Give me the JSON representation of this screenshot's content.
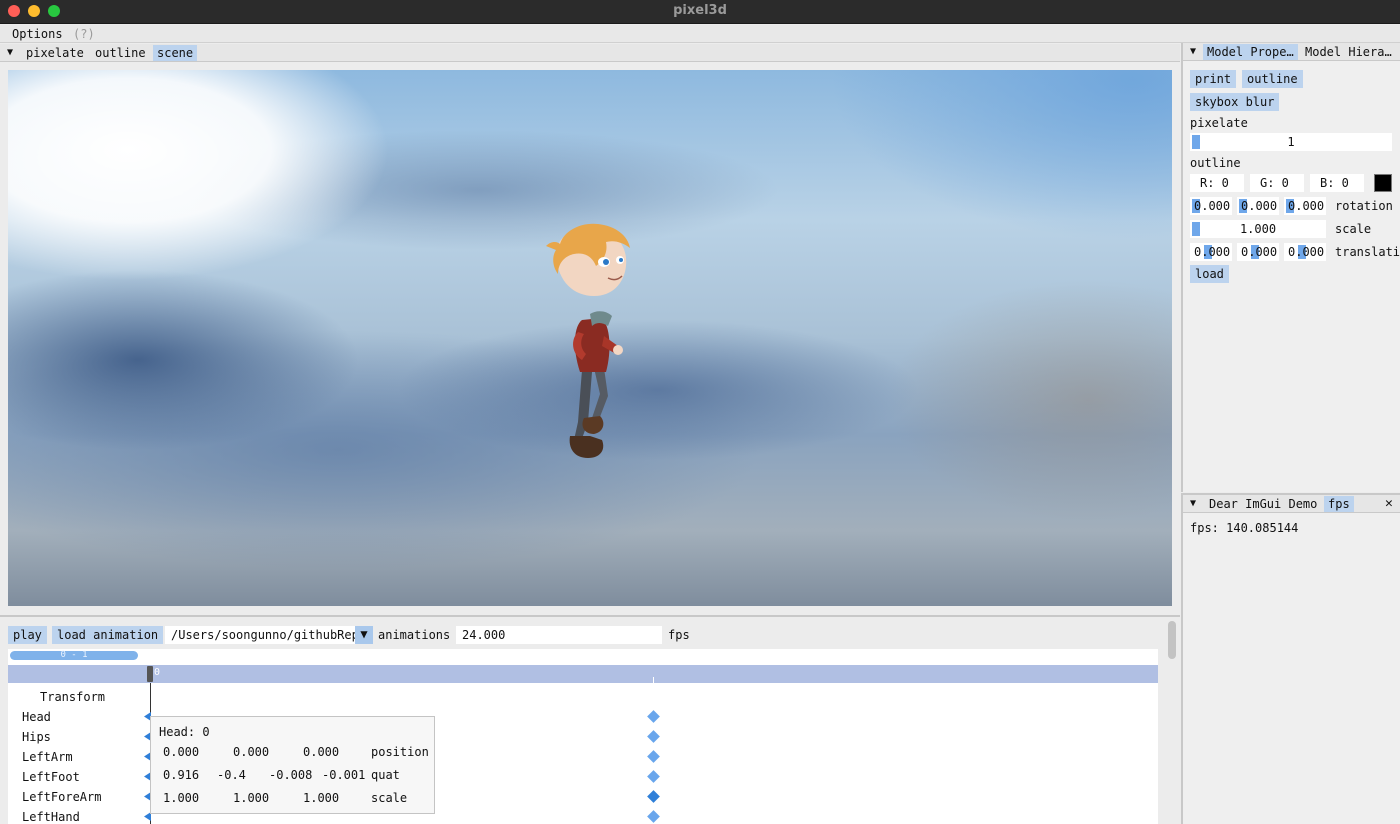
{
  "window": {
    "title": "pixel3d"
  },
  "menu": {
    "options": "Options",
    "help": "(?)"
  },
  "scene_tabs": [
    "pixelate",
    "outline",
    "scene"
  ],
  "bottom": {
    "play": "play",
    "load_animation": "load animation",
    "path": "/Users/soongunno/githubRepo",
    "animations_label": "animations",
    "fps_value": "24.000",
    "fps_label": "fps",
    "range": "0 - 1",
    "playhead": "0",
    "transform_header": "Transform",
    "tracks": [
      "Head",
      "Hips",
      "LeftArm",
      "LeftFoot",
      "LeftForeArm",
      "LeftHand"
    ]
  },
  "tooltip": {
    "title": "Head: 0",
    "position": [
      "0.000",
      "0.000",
      "0.000"
    ],
    "position_label": "position",
    "quat": [
      "0.916",
      "-0.4",
      "-0.008",
      "-0.001"
    ],
    "quat_label": "quat",
    "scale": [
      "1.000",
      "1.000",
      "1.000"
    ],
    "scale_label": "scale"
  },
  "right_tabs": [
    "Model Prope…",
    "Model Hiera…"
  ],
  "props": {
    "print": "print",
    "outline": "outline",
    "skybox_blur": "skybox blur",
    "pixelate_label": "pixelate",
    "pixelate_value": "1",
    "pixelate_level": 1,
    "outline_label": "outline",
    "r": "R:  0",
    "g": "G:  0",
    "b": "B:  0",
    "outline_color": "#000000",
    "rotation": [
      "0.000",
      "0.000",
      "0.000"
    ],
    "rotation_label": "rotation",
    "scale_value": "1.000",
    "scale_label": "scale",
    "translation": [
      "0.000",
      "0.000",
      "0.000"
    ],
    "translation_label": "translati",
    "load": "load"
  },
  "bottom_right_tabs": [
    "Dear ImGui Demo",
    "fps"
  ],
  "fps_readout": "fps: 140.085144"
}
